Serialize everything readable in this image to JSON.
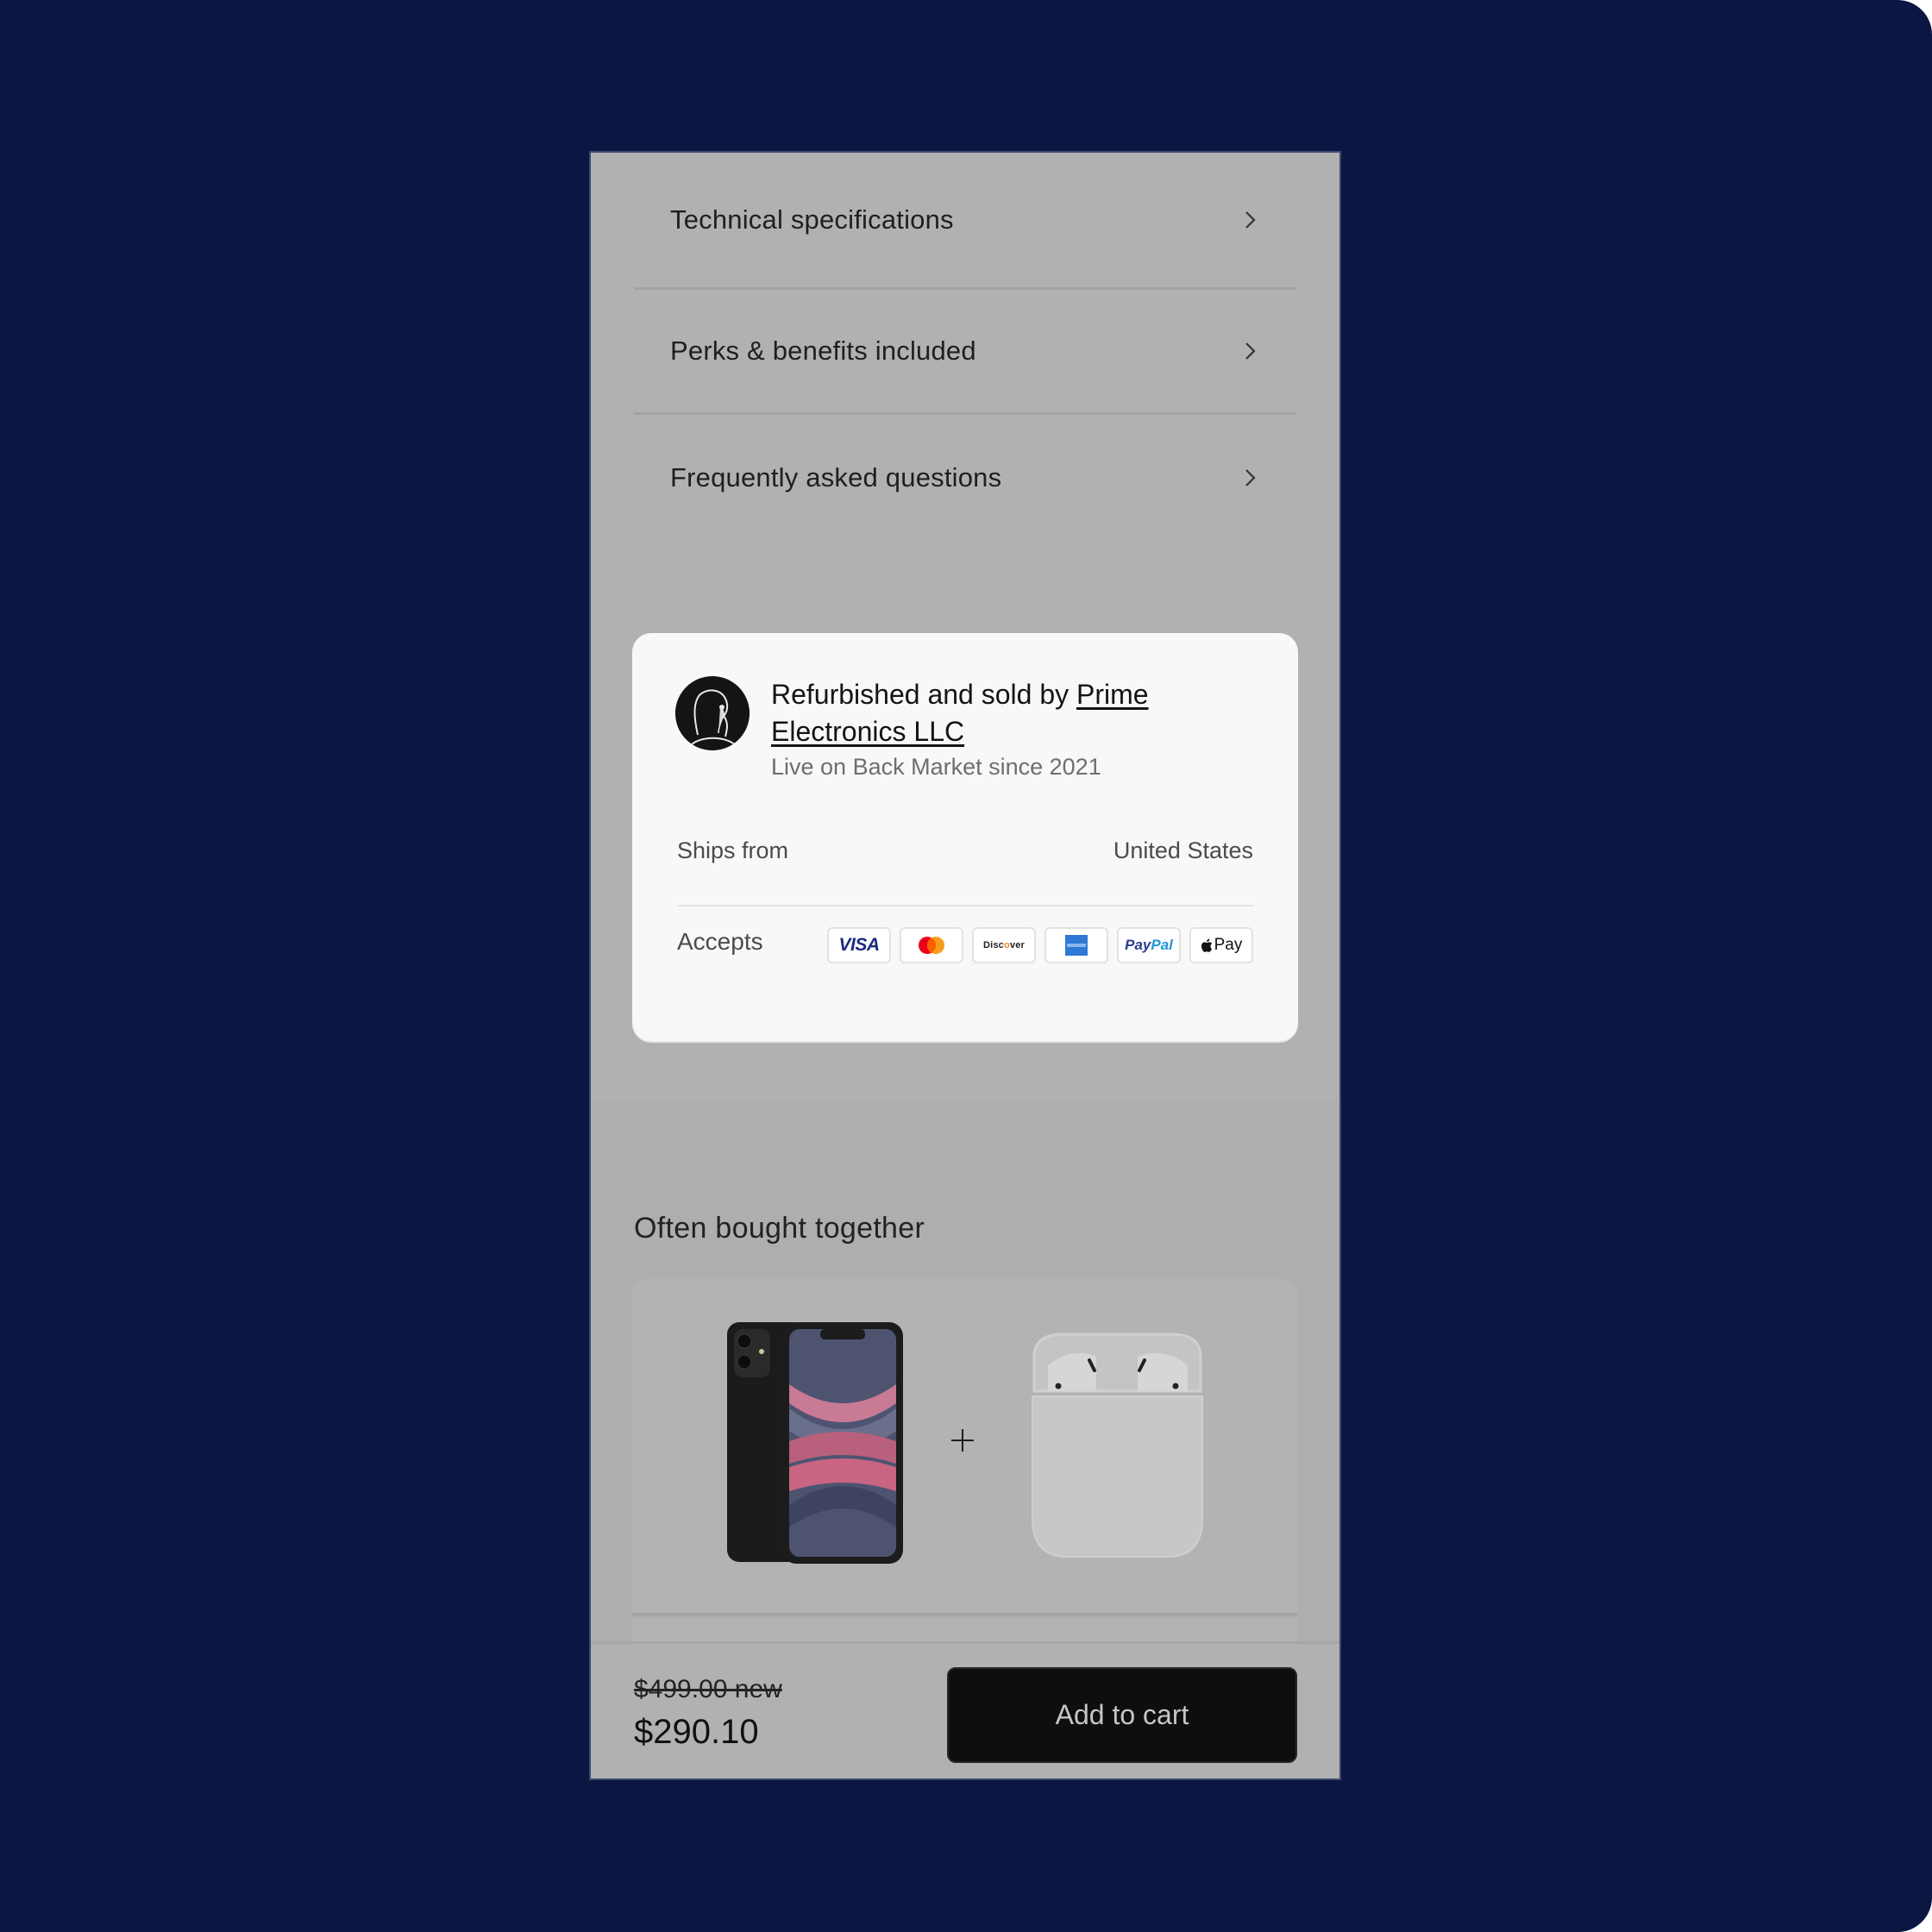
{
  "accordion": {
    "items": [
      {
        "label": "Technical specifications",
        "icon": "chevron-right-icon"
      },
      {
        "label": "Perks & benefits included",
        "icon": "chevron-right-icon"
      },
      {
        "label": "Frequently asked questions",
        "icon": "chevron-right-icon"
      }
    ]
  },
  "seller": {
    "title_prefix": "Refurbished and sold by ",
    "name": "Prime Electronics LLC",
    "since": "Live on Back Market since 2021",
    "ships_from_label": "Ships from",
    "ships_from_value": "United States",
    "accepts_label": "Accepts",
    "payment_methods": [
      {
        "name": "Visa",
        "text": "VISA"
      },
      {
        "name": "Mastercard",
        "text": ""
      },
      {
        "name": "Discover",
        "text_a": "Disc",
        "text_o": "o",
        "text_b": "ver"
      },
      {
        "name": "American Express",
        "text": ""
      },
      {
        "name": "PayPal",
        "text_a": "Pay",
        "text_b": "Pal"
      },
      {
        "name": "Apple Pay",
        "text": "Pay"
      }
    ]
  },
  "bundle": {
    "title": "Often bought together",
    "products": [
      {
        "name": "iPhone 11",
        "icon": "smartphone-image"
      },
      {
        "name": "AirPods",
        "icon": "earbuds-image"
      }
    ],
    "separator": "+"
  },
  "purchase": {
    "old_price": "$499.00 new",
    "price": "$290.10",
    "add_to_cart_label": "Add to cart"
  },
  "colors": {
    "backdrop": "#0b1742",
    "overlay": "#b1b1b1",
    "card": "#f8f8f8",
    "button": "#0e0e0e"
  }
}
